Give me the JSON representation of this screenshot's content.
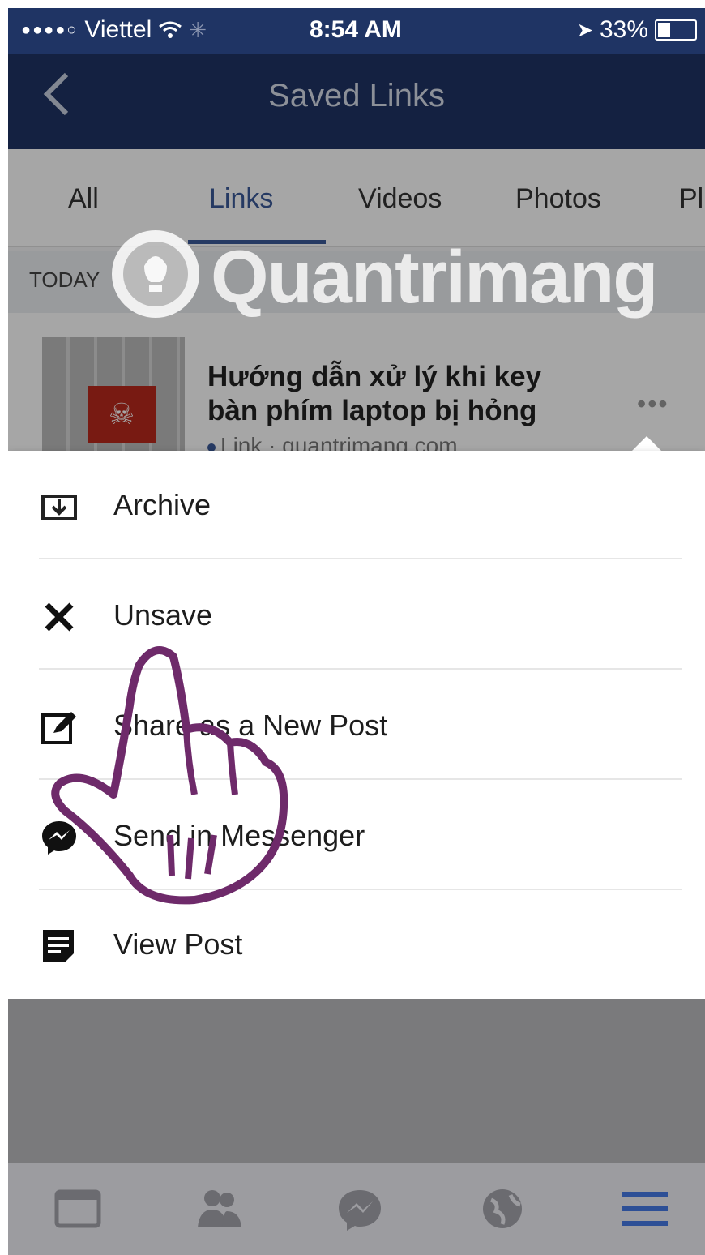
{
  "status_bar": {
    "carrier": "Viettel",
    "time": "8:54 AM",
    "battery_text": "33%",
    "battery_level": 0.33
  },
  "nav": {
    "back_icon": "chevron-left-icon",
    "title": "Saved Links"
  },
  "tabs": [
    {
      "label": "All",
      "active": false
    },
    {
      "label": "Links",
      "active": true
    },
    {
      "label": "Videos",
      "active": false
    },
    {
      "label": "Photos",
      "active": false
    },
    {
      "label": "Pl",
      "active": false
    }
  ],
  "section_header": "TODAY",
  "saved_item": {
    "title": "Hướng dẫn xử lý khi key bàn phím laptop bị hỏng",
    "meta": "Link · quantrimang.com",
    "more_label": "•••"
  },
  "menu": {
    "items": [
      {
        "icon": "archive-icon",
        "label": "Archive"
      },
      {
        "icon": "close-icon",
        "label": "Unsave"
      },
      {
        "icon": "edit-icon",
        "label": "Share as a New Post"
      },
      {
        "icon": "messenger-icon",
        "label": "Send in Messenger"
      },
      {
        "icon": "view-post-icon",
        "label": "View Post"
      }
    ]
  },
  "tabbar": {
    "items": [
      "news-feed-icon",
      "friends-icon",
      "messenger-icon",
      "globe-icon",
      "menu-icon"
    ]
  },
  "watermark": {
    "text": "Quantrimang"
  },
  "colors": {
    "facebook_blue": "#3b5998",
    "navbar": "#1f3464",
    "menu_text": "#1d1d1d",
    "overlay_hand": "#6e2a6a"
  }
}
